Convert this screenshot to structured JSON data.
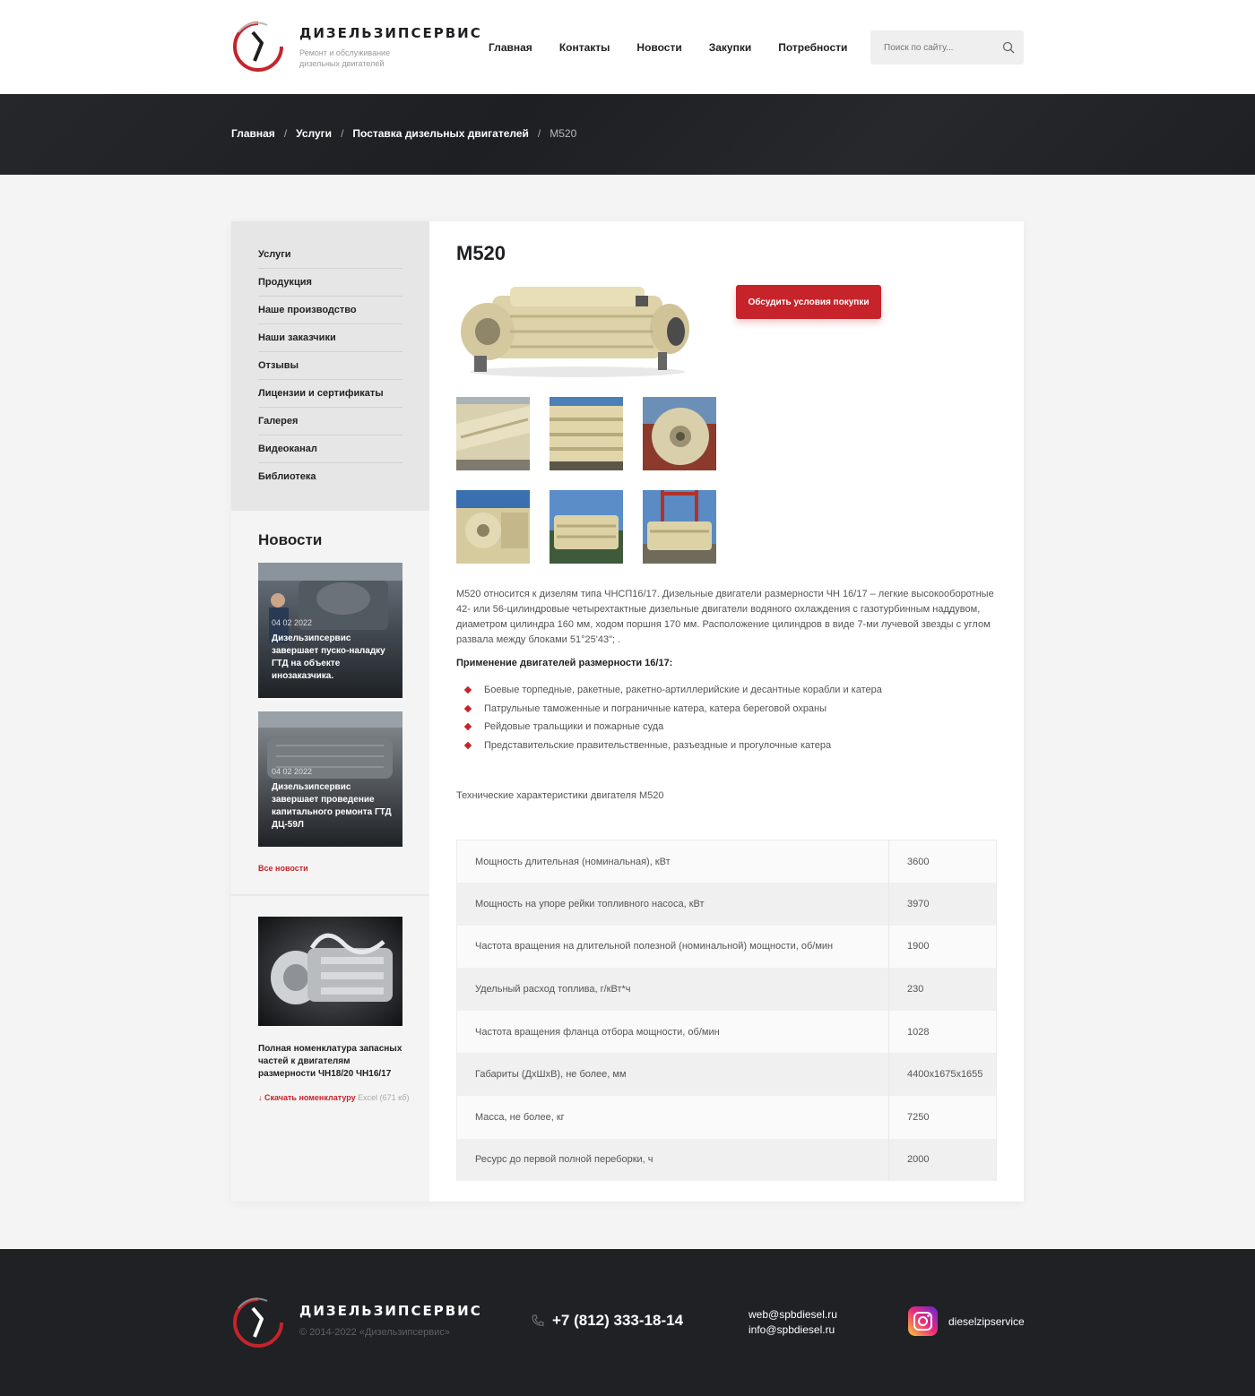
{
  "header": {
    "logo_name": "ДИЗЕЛЬЗИПСЕРВИС",
    "logo_sub": "Ремонт и обслуживание дизельных двигателей",
    "nav": [
      "Главная",
      "Контакты",
      "Новости",
      "Закупки",
      "Потребности"
    ],
    "search_placeholder": "Поиск по сайту..."
  },
  "breadcrumb": {
    "items": [
      "Главная",
      "Услуги",
      "Поставка дизельных двигателей"
    ],
    "current": "М520",
    "separator": "/"
  },
  "sidebar": {
    "menu": [
      "Услуги",
      "Продукция",
      "Наше производство",
      "Наши заказчики",
      "Отзывы",
      "Лицензии и сертификаты",
      "Галерея",
      "Видеоканал",
      "Библиотека"
    ],
    "news_title": "Новости",
    "news": [
      {
        "date": "04 02 2022",
        "title": "Дизельзипсервис завершает пуско-наладку ГТД на объекте инозаказчика."
      },
      {
        "date": "04 02 2022",
        "title": "Дизельзипсервис завершает проведение капитального ремонта ГТД ДЦ-59Л"
      }
    ],
    "all_news": "Все новости",
    "promo": {
      "text": "Полная номенклатура запасных частей к двигателям размерности ЧН18/20 ЧН16/17",
      "download_label": "↓ Скачать номенклатуру",
      "file_info": "Excel (671 кб)"
    }
  },
  "main": {
    "title": "М520",
    "buy_button": "Обсудить условия покупки",
    "description": "М520 относится к дизелям типа ЧНСП16/17. Дизельные двигатели размерности ЧН 16/17 – легкие высокооборотные 42- или 56-цилиндровые четырехтактные дизельные двигатели водяного охлаждения с газотурбинным наддувом, диаметром цилиндра 160 мм, ходом поршня 170 мм. Расположение цилиндров в виде 7-ми лучевой звезды с углом развала между блоками 51°25'43\"; .",
    "application_title": "Применение двигателей размерности 16/17:",
    "applications": [
      "Боевые торпедные, ракетные, ракетно-артиллерийские и десантные корабли и катера",
      "Патрульные таможенные и пограничные катера, катера береговой охраны",
      "Рейдовые тральщики и пожарные суда",
      "Представительские правительственные, разъездные и прогулочные катера"
    ],
    "tech_title": "Технические характеристики двигателя М520",
    "tech": [
      {
        "name": "Мощность длительная (номинальная), кВт",
        "value": "3600"
      },
      {
        "name": "Мощность на упоре рейки топливного насоса, кВт",
        "value": "3970"
      },
      {
        "name": "Частота вращения на длительной полезной (номинальной) мощности, об/мин",
        "value": "1900"
      },
      {
        "name": "Удельный расход топлива, г/кВт*ч",
        "value": "230"
      },
      {
        "name": "Частота вращения фланца отбора мощности, об/мин",
        "value": "1028"
      },
      {
        "name": "Габариты (ДхШхВ), не более, мм",
        "value": "4400x1675x1655"
      },
      {
        "name": "Масса, не более, кг",
        "value": "7250"
      },
      {
        "name": "Ресурс до первой полной переборки, ч",
        "value": "2000"
      }
    ]
  },
  "footer": {
    "logo_name": "ДИЗЕЛЬЗИПСЕРВИС",
    "copyright": "© 2014-2022 «Дизельзипсервис»",
    "phone": "+7 (812) 333-18-14",
    "emails": [
      "web@spbdiesel.ru",
      "info@spbdiesel.ru"
    ],
    "instagram": "dieselzipservice"
  },
  "colors": {
    "accent": "#c6232b",
    "dark": "#1f2124"
  }
}
